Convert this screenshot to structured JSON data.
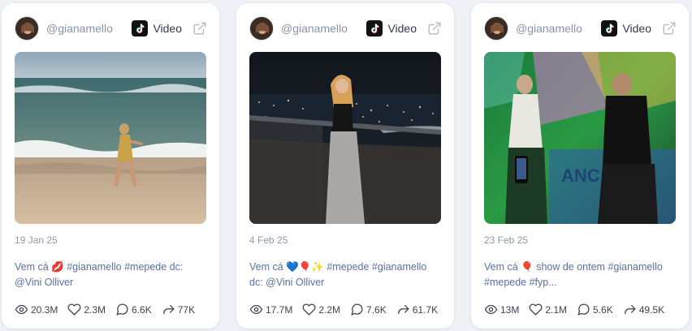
{
  "posts": [
    {
      "username": "@gianamello",
      "platform_label": "Video",
      "date": "19 Jan 25",
      "caption": "Vem cá 💋 #gianamello #mepede dc: @Vini Olliver",
      "stats": {
        "views": "20.3M",
        "likes": "2.3M",
        "comments": "6.6K",
        "shares": "77K"
      }
    },
    {
      "username": "@gianamello",
      "platform_label": "Video",
      "date": "4 Feb 25",
      "caption": "Vem cá 💙🎈✨ #mepede #gianamello dc: @Vini Olliver",
      "stats": {
        "views": "17.7M",
        "likes": "2.2M",
        "comments": "7.6K",
        "shares": "61.7K"
      }
    },
    {
      "username": "@gianamello",
      "platform_label": "Video",
      "date": "23 Feb 25",
      "caption": "Vem cá 🎈 show de ontem #gianamello #mepede #fyp...",
      "stats": {
        "views": "13M",
        "likes": "2.1M",
        "comments": "5.6K",
        "shares": "49.5K"
      }
    }
  ],
  "icons": {
    "views": "eye-icon",
    "likes": "heart-icon",
    "comments": "comment-icon",
    "shares": "share-icon",
    "platform": "tiktok-icon",
    "open": "external-link-icon"
  },
  "colors": {
    "background": "#eef1f6",
    "card": "#ffffff",
    "username": "#8a93a3",
    "caption": "#5b6fa3",
    "date": "#8f97a6",
    "stats": "#3c4352"
  }
}
